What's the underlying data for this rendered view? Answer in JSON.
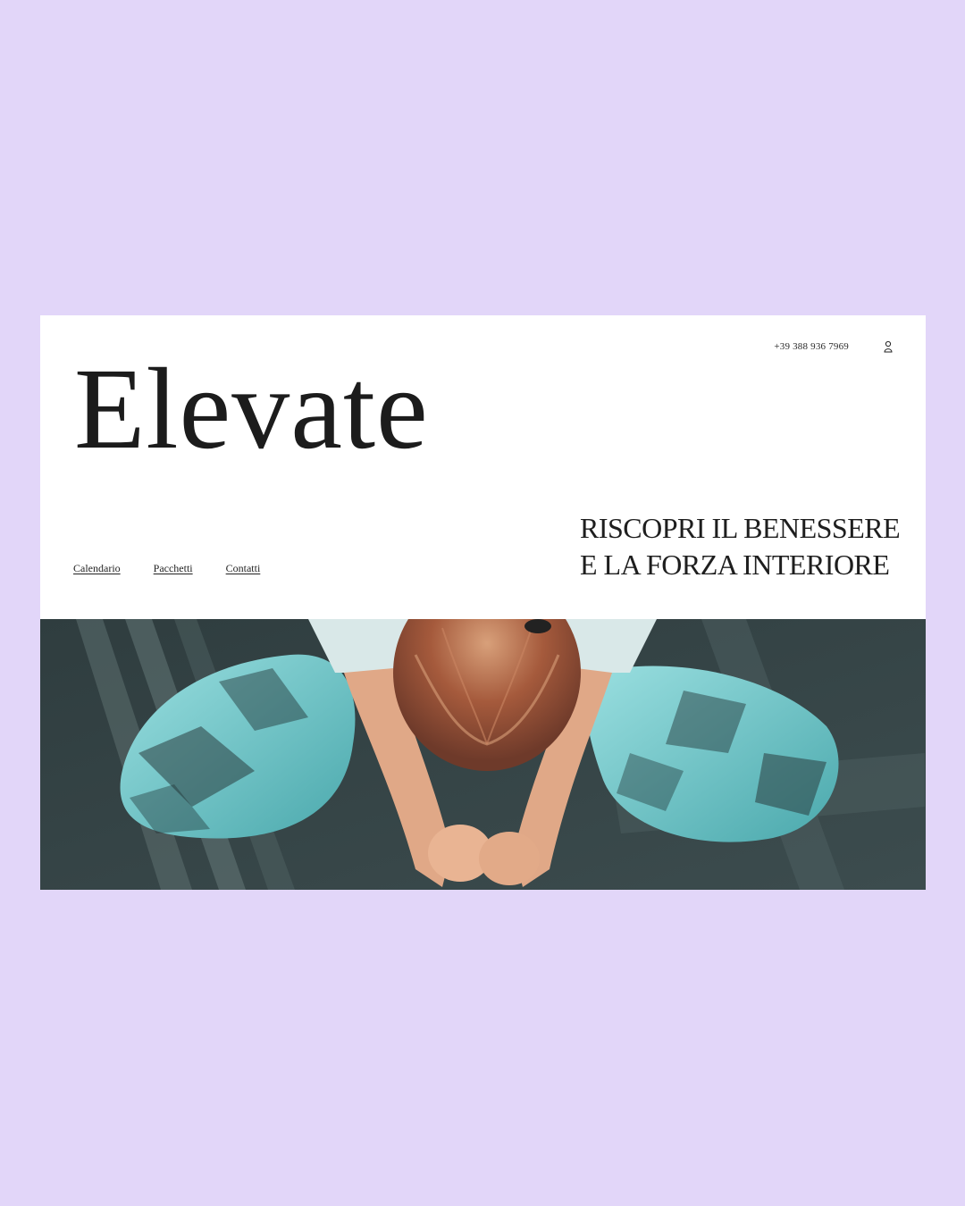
{
  "header": {
    "phone": "+39 388 936 7969",
    "user_icon": "user-icon",
    "logo": "Elevate"
  },
  "nav": {
    "items": [
      {
        "label": "Calendario"
      },
      {
        "label": "Pacchetti"
      },
      {
        "label": "Contatti"
      }
    ]
  },
  "hero": {
    "tagline_line1": "RISCOPRI IL BENESSERE",
    "tagline_line2": "E LA FORZA INTERIORE",
    "image_icon": "yoga-photo"
  },
  "colors": {
    "background": "#e2d6f9",
    "page": "#ffffff",
    "text": "#1e1e1e",
    "photo_floor": "#3b4c4d",
    "photo_teal": "#6cc6c9",
    "photo_hair": "#a0523a"
  }
}
